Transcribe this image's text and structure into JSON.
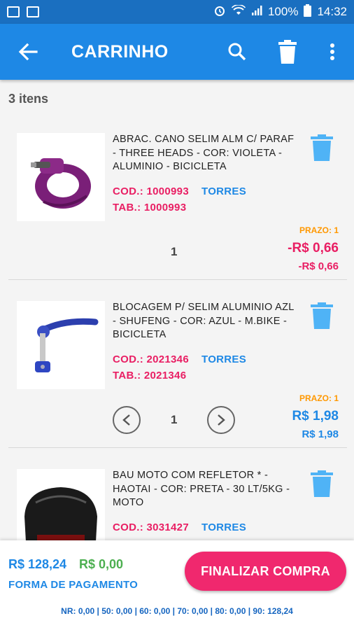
{
  "statusbar": {
    "battery": "100%",
    "time": "14:32"
  },
  "header": {
    "title": "CARRINHO"
  },
  "cart": {
    "count_label": "3 itens",
    "items": [
      {
        "description": "ABRAC. CANO SELIM ALM C/ PARAF - THREE HEADS - COR: VIOLETA - ALUMINIO - BICICLETA",
        "cod": "COD.: 1000993",
        "store": "TORRES",
        "tab": "TAB.: 1000993",
        "quantity": "1",
        "prazo": "PRAZO: 1",
        "price": "-R$ 0,66",
        "price_secondary": "-R$ 0,66",
        "price_color": "#e91e63"
      },
      {
        "description": "BLOCAGEM P/ SELIM ALUMINIO AZL - SHUFENG - COR: AZUL - M.BIKE - BICICLETA",
        "cod": "COD.: 2021346",
        "store": "TORRES",
        "tab": "TAB.: 2021346",
        "quantity": "1",
        "prazo": "PRAZO: 1",
        "price": "R$ 1,98",
        "price_secondary": "R$ 1,98",
        "price_color": "#1e88e5"
      },
      {
        "description": "BAU MOTO COM REFLETOR * - HAOTAI - COR: PRETA - 30 LT/5KG - MOTO",
        "cod": "COD.: 3031427",
        "store": "TORRES"
      }
    ]
  },
  "footer": {
    "total": "R$ 128,24",
    "total_discount": "R$ 0,00",
    "payment_label": "FORMA DE PAGAMENTO",
    "finish_label": "FINALIZAR COMPRA",
    "ranges": "NR: 0,00 | 50: 0,00 | 60: 0,00 | 70: 0,00 | 80: 0,00 | 90: 128,24"
  },
  "colors": {
    "appbar": "#1e88e5",
    "accent_pink": "#e91e63",
    "accent_blue": "#1e88e5",
    "accent_green": "#4caf50",
    "prazo_orange": "#ff9800"
  }
}
